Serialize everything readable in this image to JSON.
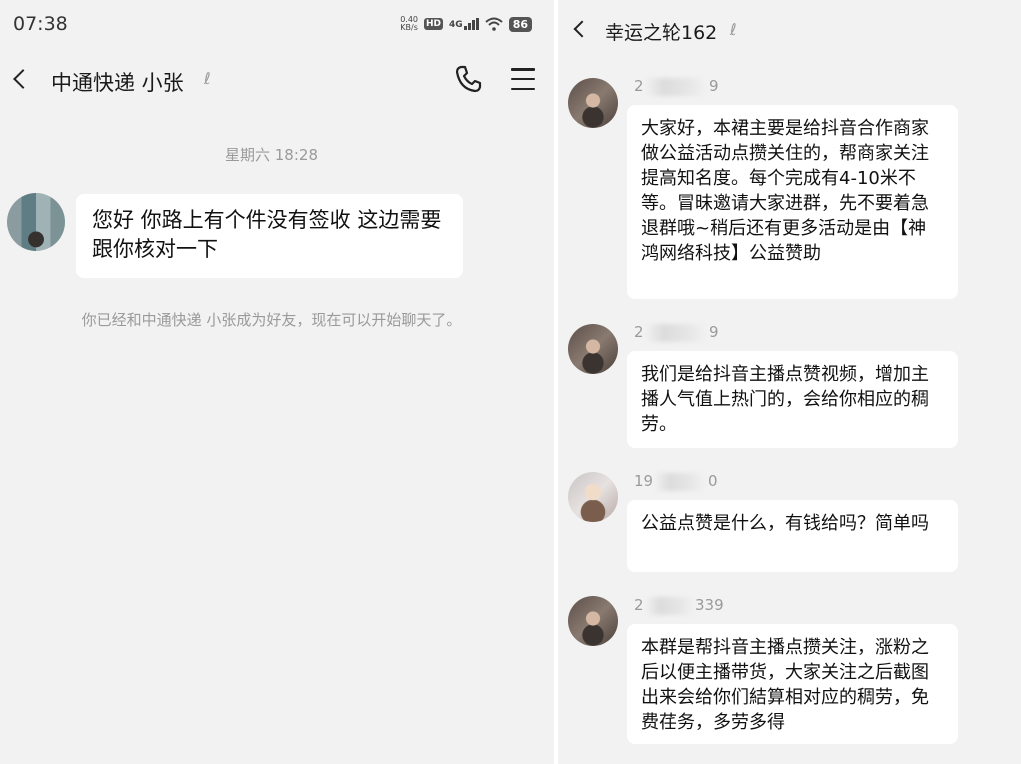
{
  "status_bar": {
    "time": "07:38",
    "speed": "0.40",
    "speed_unit": "KB/s",
    "hd": "HD",
    "network": "4G",
    "battery": "86"
  },
  "left_chat": {
    "title": "中通快递 小张",
    "timestamp": "星期六 18:28",
    "message": "您好 你路上有个件没有签收 这边需要跟你核对一下",
    "system_note": "你已经和中通快递 小张成为好友，现在可以开始聊天了。"
  },
  "right_chat": {
    "title": "幸运之轮162",
    "messages": [
      {
        "sender_prefix": "2",
        "sender_suffix": "9",
        "text": "大家好，本裙主要是给抖音合作商家做公益活动点攒关住的，帮商家关注提高知名度。每个完成有4-10米不等。冒昧邀请大家进群，先不要着急退群哦~稍后还有更多活动是由【神鸿网络科技】公益赞助"
      },
      {
        "sender_prefix": "2",
        "sender_suffix": "9",
        "text": "我们是给抖音主播点赞视频，增加主播人气值上热门的，会给你相应的稠劳。"
      },
      {
        "sender_prefix": "19",
        "sender_suffix": "0",
        "text": "公益点赞是什么，有钱给吗？简单吗"
      },
      {
        "sender_prefix": "2",
        "sender_suffix": "339",
        "text": "本群是帮抖音主播点攒关注，涨粉之后以便主播带货，大家关注之后截图出来会给你们結算相对应的稠劳，免费荏务，多劳多得"
      }
    ]
  },
  "colors": {
    "background": "#f2f2f2",
    "bubble": "#ffffff",
    "secondary_text": "#9a9a9a"
  }
}
